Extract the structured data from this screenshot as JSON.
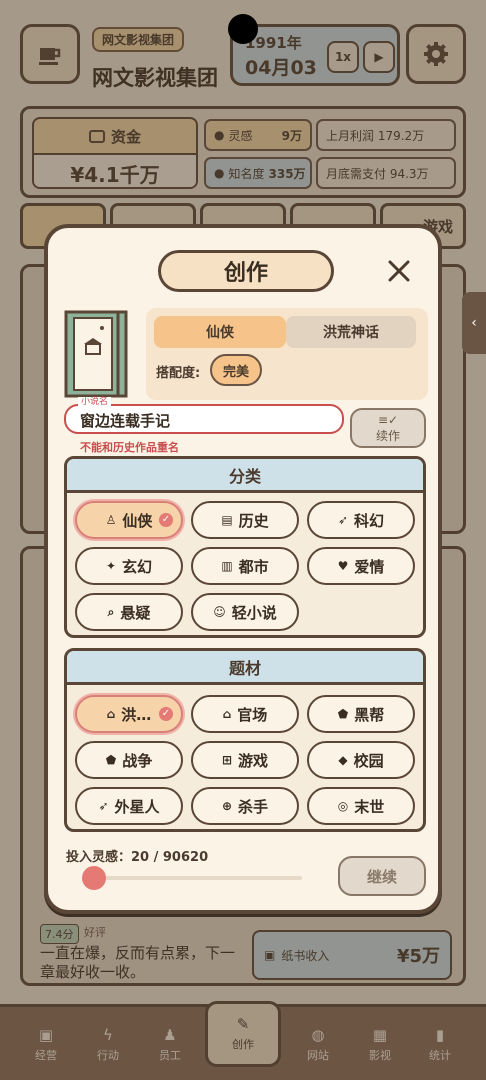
{
  "header": {
    "company_tag": "网文影视集团",
    "company_name": "网文影视集团",
    "date_year": "1991年",
    "date_day": "04月03",
    "speed_label": "1x"
  },
  "stats": {
    "fund_label": "资金",
    "fund_value": "¥4.1千万",
    "inspiration_label": "灵感",
    "inspiration_value": "9万",
    "fame_label": "知名度",
    "fame_value": "335万",
    "last_month_profit": "上月利润 179.2万",
    "month_end_payment": "月底需支付 94.3万"
  },
  "bg_tab_partial": "游戏",
  "bg_review": {
    "score": "7.4分",
    "tag": "好评",
    "text": "一直在爆，反而有点累，下一章最好收一收。"
  },
  "bg_income": {
    "label": "纸书收入",
    "value": "¥5万"
  },
  "modal": {
    "title": "创作",
    "genre_tabs": [
      "仙侠",
      "洪荒神话"
    ],
    "match_label": "搭配度:",
    "match_value": "完美",
    "name_caption": "小说名",
    "name_value": "窗边连载手记",
    "name_error": "不能和历史作品重名",
    "continue_write": "续作",
    "category_title": "分类",
    "categories": [
      {
        "label": "仙侠",
        "icon": "meditation-icon",
        "selected": true
      },
      {
        "label": "历史",
        "icon": "scroll-icon",
        "selected": false
      },
      {
        "label": "科幻",
        "icon": "rocket-icon",
        "selected": false
      },
      {
        "label": "玄幻",
        "icon": "sparkle-icon",
        "selected": false
      },
      {
        "label": "都市",
        "icon": "city-icon",
        "selected": false
      },
      {
        "label": "爱情",
        "icon": "heart-icon",
        "selected": false
      },
      {
        "label": "悬疑",
        "icon": "magnifier-icon",
        "selected": false
      },
      {
        "label": "轻小说",
        "icon": "smile-icon",
        "selected": false
      }
    ],
    "theme_title": "题材",
    "themes": [
      {
        "label": "洪…",
        "icon": "temple-icon",
        "selected": true
      },
      {
        "label": "官场",
        "icon": "government-icon",
        "selected": false
      },
      {
        "label": "黑帮",
        "icon": "shield-icon",
        "selected": false
      },
      {
        "label": "战争",
        "icon": "shield-icon",
        "selected": false
      },
      {
        "label": "游戏",
        "icon": "gamepad-icon",
        "selected": false
      },
      {
        "label": "校园",
        "icon": "graduation-cap-icon",
        "selected": false
      },
      {
        "label": "外星人",
        "icon": "rocket-icon",
        "selected": false
      },
      {
        "label": "杀手",
        "icon": "crosshair-icon",
        "selected": false
      },
      {
        "label": "末世",
        "icon": "radiation-icon",
        "selected": false
      }
    ],
    "inspiration_input_label": "投入灵感：20 / 90620",
    "inspiration_fraction": 0.0002,
    "next_button": "继续"
  },
  "bottom_nav": [
    {
      "label": "经营",
      "icon": "briefcase-icon"
    },
    {
      "label": "行动",
      "icon": "lightning-icon"
    },
    {
      "label": "员工",
      "icon": "people-icon"
    },
    {
      "label": "创作",
      "icon": "pencil-icon",
      "active": true
    },
    {
      "label": "网站",
      "icon": "globe-icon"
    },
    {
      "label": "影视",
      "icon": "clapper-icon"
    },
    {
      "label": "统计",
      "icon": "bar-chart-icon"
    }
  ],
  "colors": {
    "accent_orange": "#f6c48a",
    "accent_blue": "#cfe1e8",
    "error_red": "#c94f4f",
    "selected_check": "#e57a74",
    "border_brown": "#5a4636"
  }
}
